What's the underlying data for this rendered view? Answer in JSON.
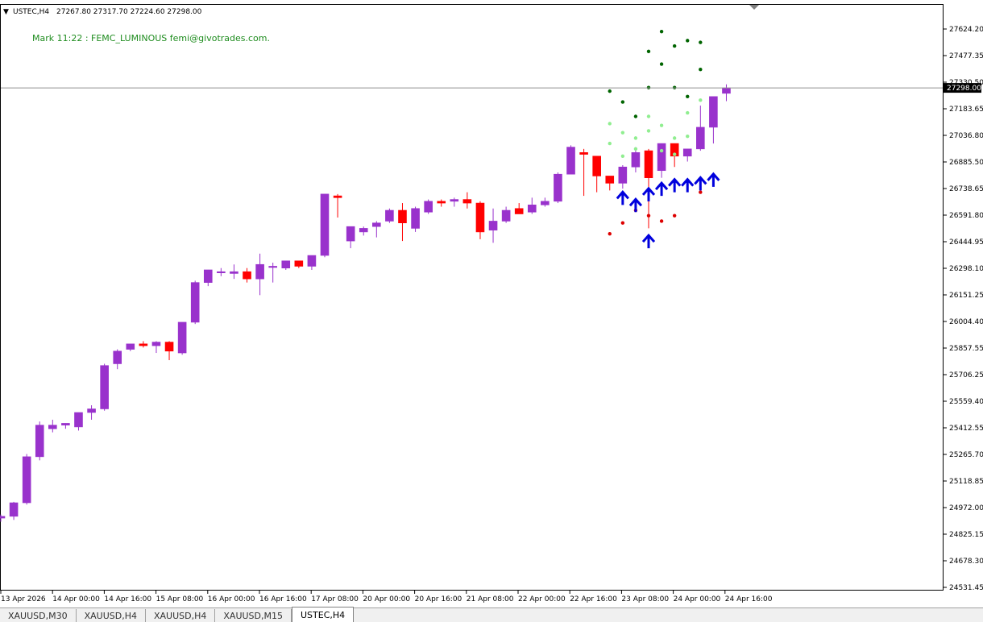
{
  "header": {
    "menu_arrow": "▼",
    "symbol": "USTEC,H4",
    "ohlc": "27267.80 27317.70 27224.60 27298.00"
  },
  "note": "Mark 11:22 : FEMC_LUMINOUS  femi@givotrades.com.",
  "tabs": [
    {
      "label": "XAUUSD,M30",
      "active": false
    },
    {
      "label": "XAUUSD,H4",
      "active": false
    },
    {
      "label": "XAUUSD,H4",
      "active": false
    },
    {
      "label": "XAUUSD,M15",
      "active": false
    },
    {
      "label": "USTEC,H4",
      "active": true
    }
  ],
  "colors": {
    "bull": "#9932cc",
    "bear": "#ff0000",
    "arrow": "#0000dd",
    "dot_dark_green": "#006400",
    "dot_light_green": "#90ee90",
    "dot_red": "#dd0000"
  },
  "chart_data": {
    "type": "candlestick",
    "symbol": "USTEC",
    "timeframe": "H4",
    "current_price": "27298.00",
    "y_ticks": [
      "27624.20",
      "27477.35",
      "27330.50",
      "27183.65",
      "27036.80",
      "26885.50",
      "26738.65",
      "26591.80",
      "26444.95",
      "26298.10",
      "26151.25",
      "26004.40",
      "25857.55",
      "25706.25",
      "25559.40",
      "25412.55",
      "25265.70",
      "25118.85",
      "24972.00",
      "24825.15",
      "24678.30",
      "24531.45"
    ],
    "x_ticks": [
      "13 Apr 2026",
      "14 Apr 00:00",
      "14 Apr 16:00",
      "15 Apr 08:00",
      "16 Apr 00:00",
      "16 Apr 16:00",
      "17 Apr 08:00",
      "20 Apr 00:00",
      "20 Apr 16:00",
      "21 Apr 08:00",
      "22 Apr 00:00",
      "22 Apr 16:00",
      "23 Apr 08:00",
      "24 Apr 00:00",
      "24 Apr 16:00"
    ],
    "candles": [
      [
        24915,
        24935,
        24895,
        24925
      ],
      [
        24925,
        25005,
        24905,
        25000
      ],
      [
        25000,
        25270,
        24990,
        25255
      ],
      [
        25255,
        25450,
        25235,
        25430
      ],
      [
        25410,
        25460,
        25390,
        25430
      ],
      [
        25430,
        25440,
        25410,
        25440
      ],
      [
        25420,
        25500,
        25400,
        25500
      ],
      [
        25500,
        25540,
        25460,
        25520
      ],
      [
        25520,
        25770,
        25510,
        25760
      ],
      [
        25770,
        25850,
        25740,
        25840
      ],
      [
        25850,
        25880,
        25840,
        25880
      ],
      [
        25880,
        25895,
        25860,
        25870
      ],
      [
        25870,
        25895,
        25830,
        25890
      ],
      [
        25890,
        25895,
        25790,
        25840
      ],
      [
        25830,
        26000,
        25820,
        26000
      ],
      [
        26000,
        26230,
        25990,
        26220
      ],
      [
        26220,
        26290,
        26200,
        26290
      ],
      [
        26275,
        26300,
        26255,
        26280
      ],
      [
        26270,
        26320,
        26240,
        26280
      ],
      [
        26280,
        26300,
        26220,
        26240
      ],
      [
        26240,
        26380,
        26150,
        26320
      ],
      [
        26310,
        26330,
        26220,
        26310
      ],
      [
        26300,
        26340,
        26290,
        26340
      ],
      [
        26340,
        26340,
        26300,
        26310
      ],
      [
        26310,
        26370,
        26290,
        26370
      ],
      [
        26370,
        26710,
        26360,
        26710
      ],
      [
        26700,
        26710,
        26580,
        26690
      ],
      [
        26450,
        26530,
        26410,
        26530
      ],
      [
        26500,
        26530,
        26480,
        26520
      ],
      [
        26530,
        26560,
        26470,
        26550
      ],
      [
        26560,
        26630,
        26550,
        26620
      ],
      [
        26620,
        26660,
        26450,
        26550
      ],
      [
        26520,
        26640,
        26500,
        26630
      ],
      [
        26610,
        26680,
        26600,
        26670
      ],
      [
        26670,
        26680,
        26640,
        26660
      ],
      [
        26670,
        26690,
        26640,
        26680
      ],
      [
        26680,
        26720,
        26630,
        26660
      ],
      [
        26660,
        26670,
        26460,
        26500
      ],
      [
        26510,
        26630,
        26440,
        26560
      ],
      [
        26560,
        26640,
        26550,
        26620
      ],
      [
        26630,
        26660,
        26600,
        26600
      ],
      [
        26610,
        26690,
        26600,
        26650
      ],
      [
        26650,
        26690,
        26640,
        26670
      ],
      [
        26670,
        26830,
        26660,
        26820
      ],
      [
        26820,
        26980,
        26820,
        26970
      ],
      [
        26940,
        26960,
        26700,
        26930
      ],
      [
        26920,
        26920,
        26720,
        26810
      ],
      [
        26810,
        26800,
        26730,
        26770
      ],
      [
        26770,
        26870,
        26740,
        26860
      ],
      [
        26860,
        26970,
        26830,
        26940
      ],
      [
        26950,
        26960,
        26520,
        26800
      ],
      [
        26840,
        26990,
        26800,
        26990
      ],
      [
        26990,
        26990,
        26860,
        26920
      ],
      [
        26920,
        26960,
        26890,
        26960
      ],
      [
        26960,
        27200,
        26950,
        27080
      ],
      [
        27080,
        27250,
        26990,
        27250
      ],
      [
        27267.8,
        27317.7,
        27224.6,
        27298
      ]
    ],
    "signals_up_arrows": [
      {
        "index": 48,
        "price": 26690
      },
      {
        "index": 49,
        "price": 26650
      },
      {
        "index": 50,
        "price": 26450
      },
      {
        "index": 50,
        "price": 26710
      },
      {
        "index": 51,
        "price": 26740
      },
      {
        "index": 52,
        "price": 26760
      },
      {
        "index": 53,
        "price": 26760
      },
      {
        "index": 54,
        "price": 26770
      },
      {
        "index": 55,
        "price": 26790
      }
    ],
    "upper_dots_dark_green": [
      [
        47,
        27280
      ],
      [
        48,
        27220
      ],
      [
        49,
        27140
      ],
      [
        50,
        27300
      ],
      [
        50,
        27500
      ],
      [
        51,
        27430
      ],
      [
        51,
        27610
      ],
      [
        52,
        27300
      ],
      [
        52,
        27530
      ],
      [
        53,
        27250
      ],
      [
        53,
        27560
      ],
      [
        54,
        27400
      ],
      [
        54,
        27550
      ]
    ],
    "upper_dots_light_green": [
      [
        47,
        27100
      ],
      [
        47,
        26990
      ],
      [
        48,
        27050
      ],
      [
        48,
        26920
      ],
      [
        49,
        27020
      ],
      [
        49,
        26960
      ],
      [
        50,
        27140
      ],
      [
        50,
        27060
      ],
      [
        51,
        27090
      ],
      [
        51,
        26950
      ],
      [
        52,
        27020
      ],
      [
        52,
        26930
      ],
      [
        53,
        27160
      ],
      [
        53,
        27030
      ],
      [
        54,
        27230
      ]
    ],
    "lower_dots_red": [
      [
        47,
        26490
      ],
      [
        48,
        26550
      ],
      [
        49,
        26620
      ],
      [
        50,
        26590
      ],
      [
        51,
        26560
      ],
      [
        52,
        26590
      ],
      [
        54,
        26720
      ]
    ]
  }
}
